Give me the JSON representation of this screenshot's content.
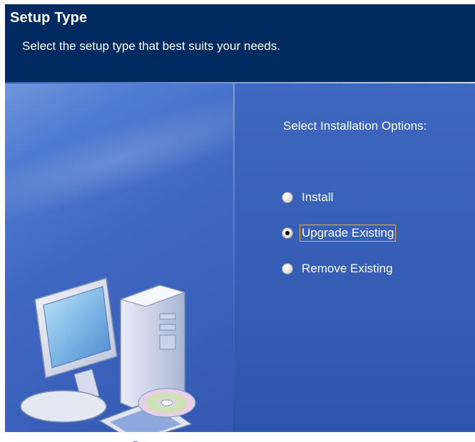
{
  "header": {
    "title": "Setup Type",
    "subtitle": "Select the setup type that best suits your needs."
  },
  "options": {
    "title": "Select Installation Options:",
    "items": [
      {
        "label": "Install",
        "selected": false
      },
      {
        "label": "Upgrade Existing",
        "selected": true
      },
      {
        "label": "Remove Existing",
        "selected": false
      }
    ]
  },
  "icons": {
    "illustration": "computer-with-cd-icon"
  },
  "colors": {
    "header_bg": "#002b60",
    "body_bg": "#3a64bb",
    "focus_outline": "#e2b04a"
  }
}
